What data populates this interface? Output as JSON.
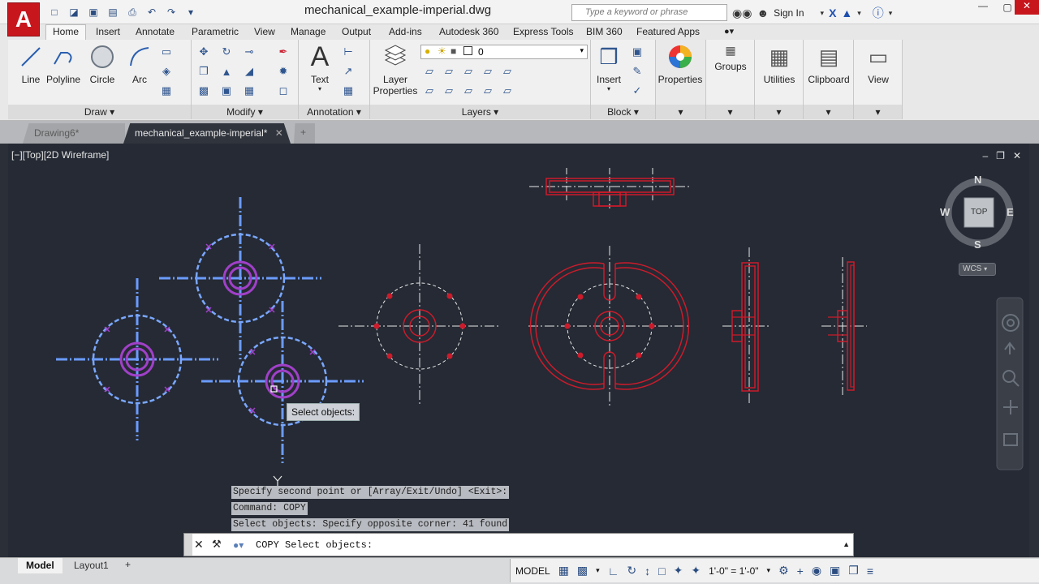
{
  "app": {
    "button_letter": "A"
  },
  "titlebar": {
    "document_title": "mechanical_example-imperial.dwg",
    "search_placeholder": "Type a keyword or phrase",
    "sign_in": "Sign In"
  },
  "ribbon_tabs": [
    "Home",
    "Insert",
    "Annotate",
    "Parametric",
    "View",
    "Manage",
    "Output",
    "Add-ins",
    "Autodesk 360",
    "Express Tools",
    "BIM 360",
    "Featured Apps"
  ],
  "ribbon": {
    "draw": {
      "label": "Draw",
      "buttons": [
        "Line",
        "Polyline",
        "Circle",
        "Arc"
      ]
    },
    "modify": {
      "label": "Modify"
    },
    "annotation": {
      "label": "Annotation",
      "text": "Text"
    },
    "layers": {
      "label": "Layers",
      "layer_properties": "Layer\nProperties",
      "layer_properties_l1": "Layer",
      "layer_properties_l2": "Properties",
      "current_layer": "0"
    },
    "block": {
      "label": "Block",
      "insert": "Insert"
    },
    "properties": "Properties",
    "groups": "Groups",
    "utilities": "Utilities",
    "clipboard": "Clipboard",
    "view": "View"
  },
  "doc_tabs": [
    "Drawing6*",
    "mechanical_example-imperial*"
  ],
  "viewport": {
    "label": "[−][Top][2D Wireframe]",
    "viewcube": {
      "top": "TOP",
      "n": "N",
      "s": "S",
      "e": "E",
      "w": "W",
      "wcs": "WCS"
    },
    "tooltip": "Select objects:"
  },
  "command": {
    "history": [
      "Specify second point or [Array/Exit/Undo] <Exit>:",
      "Command: COPY",
      "Select objects: Specify opposite corner: 41 found"
    ],
    "current": "COPY Select objects:"
  },
  "status": {
    "layout_tabs": [
      "Model",
      "Layout1"
    ],
    "model": "MODEL",
    "scale": "1'-0\" = 1'-0\""
  },
  "colors": {
    "selected": "#5f8fff",
    "drawing_red": "#cc1b2b",
    "center_line": "#e8e8e8",
    "background": "#252a34"
  }
}
